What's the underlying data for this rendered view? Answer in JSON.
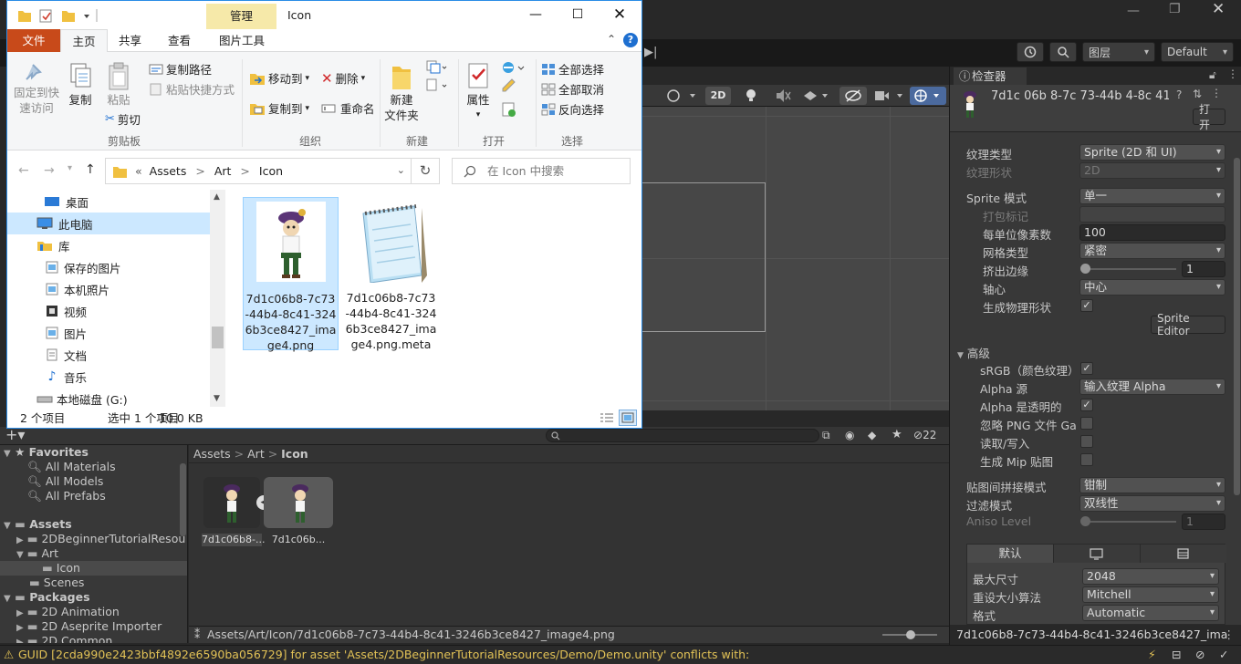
{
  "explorer": {
    "title": "Icon",
    "context_tab": "管理",
    "tabs": {
      "file": "文件",
      "home": "主页",
      "share": "共享",
      "view": "查看",
      "picture_tools": "图片工具"
    },
    "ribbon": {
      "pin": "固定到快\n速访问",
      "pin_l1": "固定到快",
      "pin_l2": "速访问",
      "copy": "复制",
      "paste": "粘贴",
      "copy_path": "复制路径",
      "paste_shortcut": "粘贴快捷方式",
      "cut": "剪切",
      "group_clipboard": "剪贴板",
      "move_to": "移动到",
      "copy_to": "复制到",
      "delete": "删除",
      "rename": "重命名",
      "group_organize": "组织",
      "new_folder_l1": "新建",
      "new_folder_l2": "文件夹",
      "group_new": "新建",
      "properties": "属性",
      "group_open": "打开",
      "select_all": "全部选择",
      "select_none": "全部取消",
      "invert_selection": "反向选择",
      "group_select": "选择"
    },
    "address": {
      "prefix": "«",
      "parts": [
        "Assets",
        "Art",
        "Icon"
      ],
      "sep": ">"
    },
    "search_placeholder": "在 Icon 中搜索",
    "nav": [
      {
        "label": "桌面"
      },
      {
        "label": "此电脑"
      },
      {
        "label": "库"
      },
      {
        "label": "保存的图片"
      },
      {
        "label": "本机照片"
      },
      {
        "label": "视频"
      },
      {
        "label": "图片"
      },
      {
        "label": "文档"
      },
      {
        "label": "音乐"
      },
      {
        "label": "本地磁盘 (G:)"
      }
    ],
    "files": [
      {
        "name_lines": [
          "7d1c06b8-7c73",
          "-44b4-8c41-324",
          "6b3ce8427_ima",
          "ge4.png"
        ]
      },
      {
        "name_lines": [
          "7d1c06b8-7c73",
          "-44b4-8c41-324",
          "6b3ce8427_ima",
          "ge4.png.meta"
        ]
      }
    ],
    "status": {
      "count": "2 个项目",
      "selected": "选中 1 个项目",
      "size": "10.0 KB"
    }
  },
  "unity": {
    "layers": "图层",
    "layout": "Default",
    "scene_2d": "2D",
    "project": {
      "favorites": "Favorites",
      "fav_items": [
        "All Materials",
        "All Models",
        "All Prefabs"
      ],
      "assets": "Assets",
      "asset_items": [
        "2DBeginnerTutorialResou",
        "Art",
        "Icon",
        "Scenes"
      ],
      "packages": "Packages",
      "package_items": [
        "2D Animation",
        "2D Aseprite Importer",
        "2D Common"
      ],
      "breadcrumb": [
        "Assets",
        "Art",
        "Icon"
      ],
      "thumb1_label": "7d1c06b8-...",
      "thumb2_label": "7d1c06b...",
      "hidden_count": "22",
      "footer_path": "Assets/Art/Icon/7d1c06b8-7c73-44b4-8c41-3246b3ce8427_image4.png"
    },
    "status_message": "GUID [2cda990e2423bbf4892e6590ba056729] for asset 'Assets/2DBeginnerTutorialResources/Demo/Demo.unity' conflicts with:",
    "inspector": {
      "tab": "检查器",
      "asset_name": "7d1c 06b 8-7c 73-44b 4-8c 41-:",
      "open_button": "打开",
      "texture_type_label": "纹理类型",
      "texture_type_value": "Sprite (2D 和 UI)",
      "texture_shape_label": "纹理形状",
      "texture_shape_value": "2D",
      "sprite_mode_label": "Sprite 模式",
      "sprite_mode_value": "单一",
      "packing_tag_label": "打包标记",
      "ppu_label": "每单位像素数",
      "ppu_value": "100",
      "mesh_type_label": "网格类型",
      "mesh_type_value": "紧密",
      "extrude_label": "挤出边缘",
      "extrude_value": "1",
      "pivot_label": "轴心",
      "pivot_value": "中心",
      "gen_physics_label": "生成物理形状",
      "sprite_editor_button": "Sprite Editor",
      "advanced_label": "高级",
      "srgb_label": "sRGB（颜色纹理）",
      "alpha_source_label": "Alpha 源",
      "alpha_source_value": "输入纹理 Alpha",
      "alpha_transparent_label": "Alpha 是透明的",
      "ignore_png_label": "忽略 PNG 文件 Gai",
      "read_write_label": "读取/写入",
      "gen_mip_label": "生成 Mip 贴图",
      "wrap_label": "贴图间拼接模式",
      "wrap_value": "钳制",
      "filter_label": "过滤模式",
      "filter_value": "双线性",
      "aniso_label": "Aniso Level",
      "aniso_value": "1",
      "platform_default": "默认",
      "max_size_label": "最大尺寸",
      "max_size_value": "2048",
      "resize_label": "重设大小算法",
      "resize_value": "Mitchell",
      "format_label": "格式",
      "format_value": "Automatic",
      "footer_name": "7d1c06b8-7c73-44b4-8c41-3246b3ce8427_ima"
    }
  },
  "colors": {
    "explorer_accent": "#2b8ce6",
    "file_tab": "#c84a1a",
    "context_tab": "#f6e9a9",
    "selection": "#cce8ff",
    "warning": "#e2c256"
  }
}
